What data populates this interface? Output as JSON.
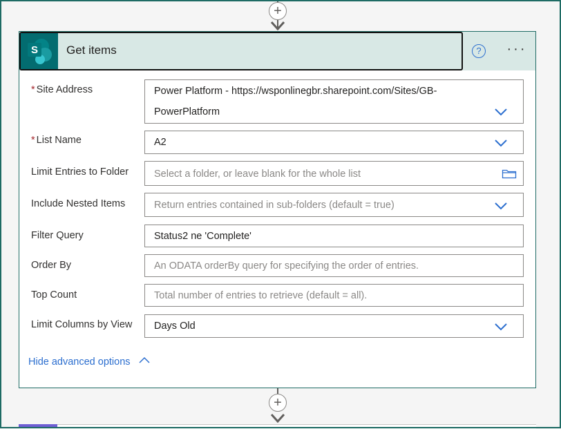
{
  "card": {
    "title": "Get items",
    "app_icon": "sharepoint-icon",
    "app_icon_letter": "S",
    "help_label": "?",
    "more_label": "···"
  },
  "fields": {
    "site_address": {
      "label": "Site Address",
      "required": "*",
      "value_line1": "Power Platform - https://wsponlinegbr.sharepoint.com/Sites/GB-",
      "value_line2": "PowerPlatform"
    },
    "list_name": {
      "label": "List Name",
      "required": "*",
      "value": "A2"
    },
    "limit_folder": {
      "label": "Limit Entries to Folder",
      "placeholder": "Select a folder, or leave blank for the whole list"
    },
    "nested_items": {
      "label": "Include Nested Items",
      "placeholder": "Return entries contained in sub-folders (default = true)"
    },
    "filter_query": {
      "label": "Filter Query",
      "value": "Status2 ne 'Complete'"
    },
    "order_by": {
      "label": "Order By",
      "placeholder": "An ODATA orderBy query for specifying the order of entries."
    },
    "top_count": {
      "label": "Top Count",
      "placeholder": "Total number of entries to retrieve (default = all)."
    },
    "limit_columns": {
      "label": "Limit Columns by View",
      "value": "Days Old"
    }
  },
  "hide_advanced": "Hide advanced options",
  "connector": {
    "add_label": "+"
  },
  "colors": {
    "accent": "#2b6ecf",
    "header_bg": "#d8e8e5",
    "sharepoint": "#036c70",
    "required": "#a4262c"
  }
}
